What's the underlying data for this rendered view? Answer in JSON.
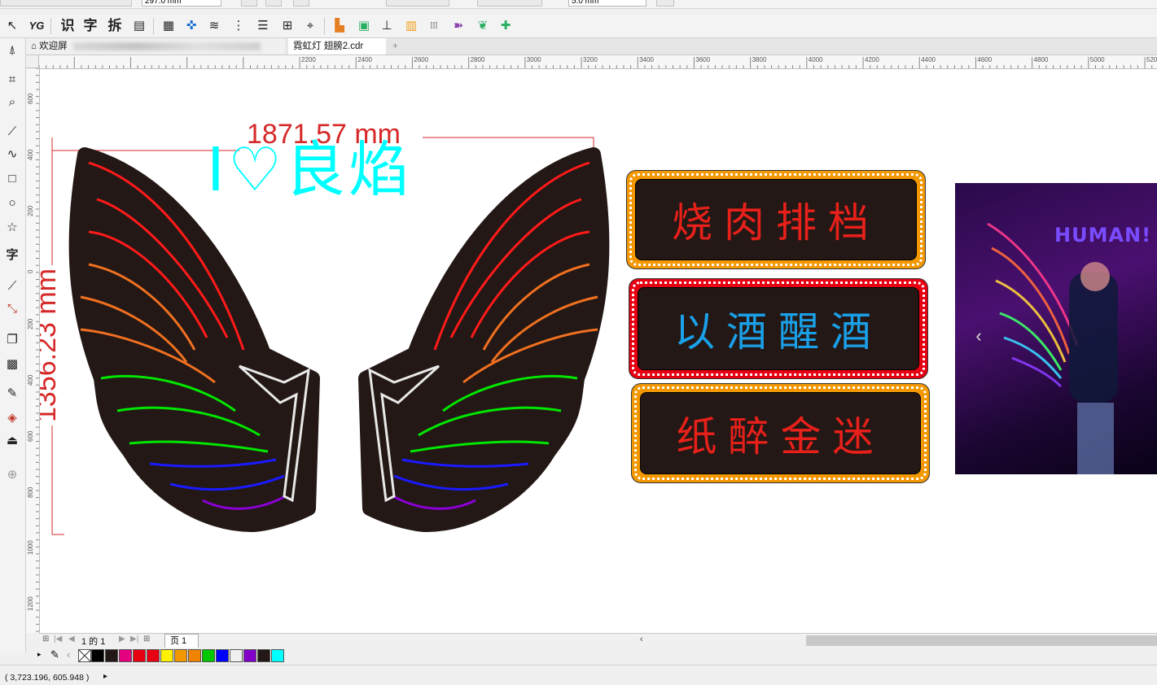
{
  "propbar": {
    "page_height": "297.0 mm",
    "nudge": "5.0 mm"
  },
  "toolbar": {
    "items": [
      "select-arrow-icon",
      "text-tool-icon",
      "识",
      "字",
      "拆",
      "copy-icon",
      "grid-icon",
      "wire-icon",
      "wave-icon",
      "node-icon",
      "lines-icon",
      "frame-icon",
      "target-icon",
      "align-icon",
      "image-icon",
      "measure-icon",
      "grid-orange-icon",
      "dots-icon",
      "swirl-icon",
      "leaf-icon",
      "puzzle-icon"
    ]
  },
  "tabs": {
    "welcome": "欢迎屏",
    "document": "霓虹灯 翅膀2.cdr",
    "add": "+"
  },
  "ruler": {
    "h_labels": [
      "2200",
      "2400",
      "2600",
      "2800",
      "3000",
      "3200",
      "3400",
      "3600",
      "3800",
      "4000",
      "4200",
      "4400",
      "4600",
      "4800",
      "5000",
      "520"
    ],
    "v_labels": [
      "600",
      "400",
      "200",
      "0",
      "200",
      "400",
      "600",
      "800",
      "1000",
      "1200"
    ]
  },
  "canvas": {
    "title_text": "I♡良焰",
    "dim_width": "1871.57 mm",
    "dim_height": "1356.23 mm",
    "signs": [
      {
        "text": "烧肉排档",
        "text_color": "#e8201a",
        "frame_color": "#f39800"
      },
      {
        "text": "以酒醒酒",
        "text_color": "#1aa0e8",
        "frame_color": "#e60012"
      },
      {
        "text": "纸醉金迷",
        "text_color": "#e8201a",
        "frame_color": "#f39800"
      }
    ],
    "photo": {
      "neon_word": "HUMAN!",
      "nav_arrow": "‹"
    }
  },
  "pagebar": {
    "page_info": "1 的 1",
    "page_tab": "页 1"
  },
  "palette": {
    "colors": [
      "#000000",
      "#231815",
      "#e4007f",
      "#e60012",
      "#e60012",
      "#fff100",
      "#f39800",
      "#f08300",
      "#00c800",
      "#0000ff",
      "#f0f0f0",
      "#8000c8",
      "#231815",
      "#00ffff"
    ]
  },
  "status": {
    "coords": "( 3,723.196, 605.948 )"
  }
}
